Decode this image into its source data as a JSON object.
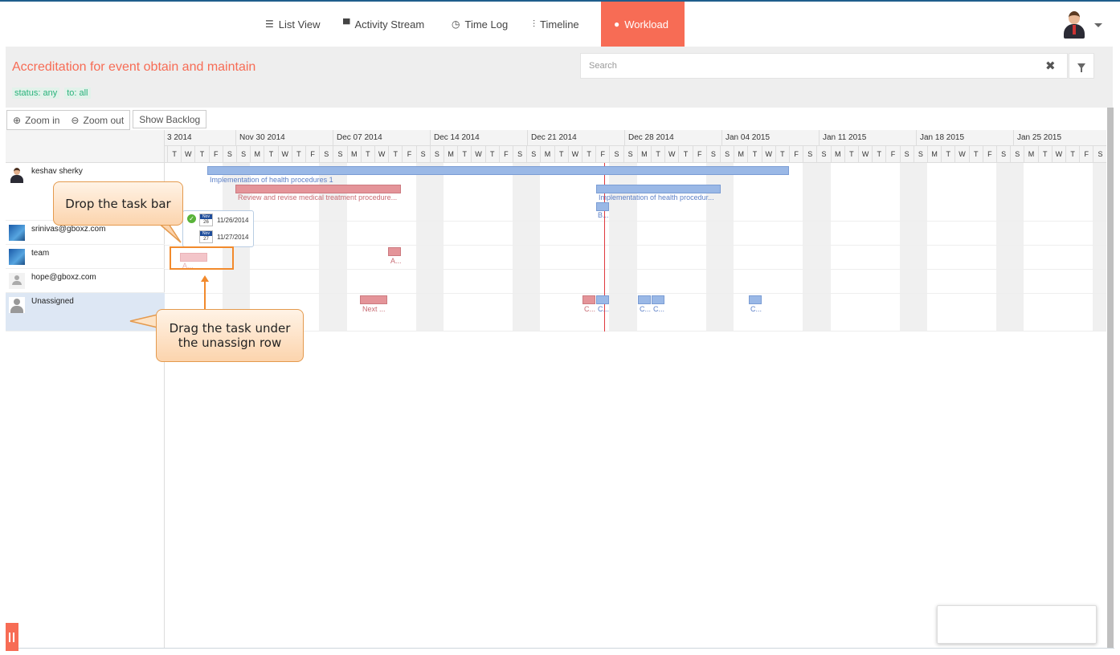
{
  "nav": {
    "tabs": [
      {
        "label": "List View",
        "icon": "list-icon"
      },
      {
        "label": "Activity Stream",
        "icon": "comment-icon"
      },
      {
        "label": "Time Log",
        "icon": "clock-icon"
      },
      {
        "label": "Timeline",
        "icon": "sliders-icon"
      },
      {
        "label": "Workload",
        "icon": "user-icon",
        "active": true
      }
    ]
  },
  "header": {
    "title": "Accreditation for event obtain and maintain",
    "filters": [
      "status: any",
      "to: all"
    ],
    "search_placeholder": "Search"
  },
  "toolbar": {
    "zoom_in": "Zoom in",
    "zoom_out": "Zoom out",
    "show_backlog": "Show Backlog"
  },
  "timeline": {
    "weeks": [
      "3 2014",
      "Nov 30 2014",
      "Dec 07 2014",
      "Dec 14 2014",
      "Dec 21 2014",
      "Dec 28 2014",
      "Jan 04 2015",
      "Jan 11 2015",
      "Jan 18 2015",
      "Jan 25 2015"
    ],
    "days": [
      "T",
      "W",
      "T",
      "F",
      "S",
      "S",
      "M",
      "T",
      "W",
      "T",
      "F",
      "S",
      "S",
      "M",
      "T",
      "W",
      "T",
      "F",
      "S",
      "S",
      "M",
      "T",
      "W",
      "T",
      "F",
      "S",
      "S",
      "M",
      "T",
      "W",
      "T",
      "F",
      "S",
      "S",
      "M",
      "T",
      "W",
      "T",
      "F",
      "S",
      "S",
      "M",
      "T",
      "W",
      "T",
      "F",
      "S",
      "S",
      "M",
      "T",
      "W",
      "T",
      "F",
      "S",
      "S",
      "M",
      "T",
      "W",
      "T",
      "F",
      "S",
      "S",
      "M",
      "T",
      "W",
      "T",
      "F",
      "S"
    ]
  },
  "resources": [
    {
      "name": "keshav sherky",
      "avatar": "person"
    },
    {
      "name": "srinivas@gboxz.com",
      "avatar": "photo"
    },
    {
      "name": "team",
      "avatar": "photo"
    },
    {
      "name": "hope@gboxz.com",
      "avatar": "pending"
    },
    {
      "name": "Unassigned",
      "avatar": "grey",
      "selected": true
    }
  ],
  "tasks": {
    "t1": "Implementation of health procedures 1",
    "t2": "Review and revise medical treatment procedure...",
    "t3": "Implementation of health procedur...",
    "t4": "B...",
    "t5": "A...",
    "t6": "A...",
    "t7": "Next ...",
    "t8": "C...",
    "t9": "C...",
    "t10": "C...",
    "t11": "C...",
    "t12": "C..."
  },
  "tooltip": {
    "start_month": "Nov",
    "start_day": "26",
    "start_date": "11/26/2014",
    "end_month": "Nov",
    "end_day": "27",
    "end_date": "11/27/2014"
  },
  "callouts": {
    "drop": "Drop the task bar",
    "drag": "Drag the task under the unassign row"
  },
  "colors": {
    "accent": "#f76c55",
    "bar_blue": "#9ab8e6",
    "bar_red": "#e49499",
    "today_line": "#e0393e",
    "callout_border": "#e49a4e"
  }
}
